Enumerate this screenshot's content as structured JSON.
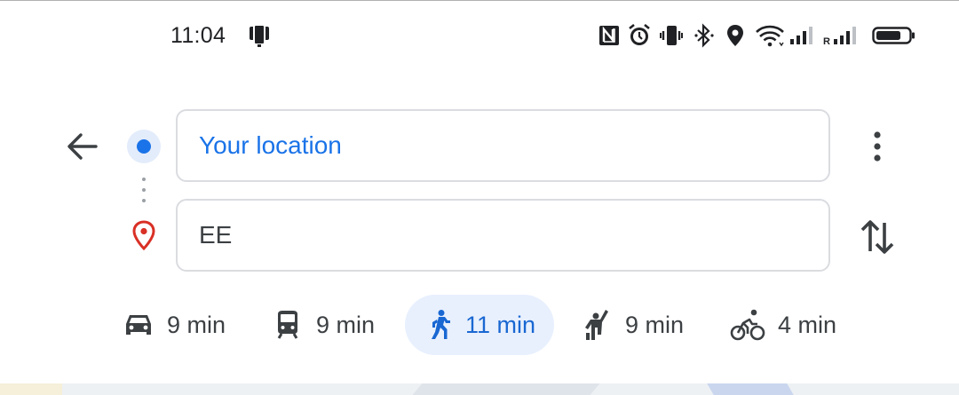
{
  "status_bar": {
    "time": "11:04",
    "icons": [
      "screenshot-notification-icon",
      "nfc-icon",
      "alarm-icon",
      "vibrate-icon",
      "bluetooth-icon",
      "location-icon",
      "wifi-icon",
      "signal-icon",
      "roaming-signal-icon",
      "battery-icon"
    ],
    "roaming_label": "R"
  },
  "directions": {
    "origin_value": "Your location",
    "destination_value": "EE",
    "accent_color": "#1a73e8",
    "destination_pin_color": "#d93025"
  },
  "modes": [
    {
      "name": "drive",
      "icon": "car-icon",
      "time": "9 min",
      "selected": false
    },
    {
      "name": "transit",
      "icon": "train-icon",
      "time": "9 min",
      "selected": false
    },
    {
      "name": "walk",
      "icon": "walk-icon",
      "time": "11 min",
      "selected": true
    },
    {
      "name": "ride-hailing",
      "icon": "hail-icon",
      "time": "9 min",
      "selected": false
    },
    {
      "name": "cycle",
      "icon": "bike-icon",
      "time": "4 min",
      "selected": false
    }
  ]
}
